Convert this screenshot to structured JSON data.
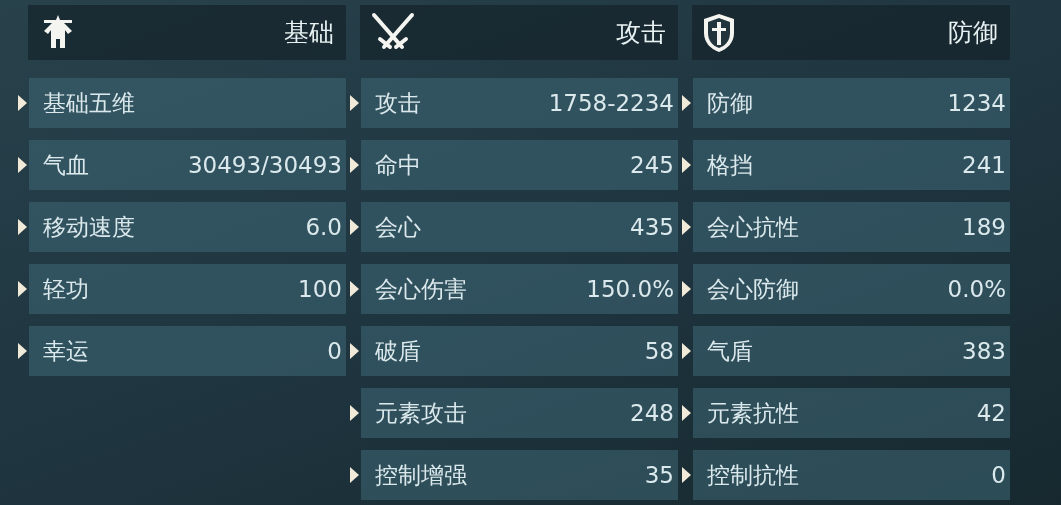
{
  "columns": [
    {
      "title": "基础",
      "rows": [
        {
          "label": "基础五维"
        },
        {
          "label": "气血",
          "value": "30493/30493"
        },
        {
          "label": "移动速度",
          "value": "6.0"
        },
        {
          "label": "轻功",
          "value": "100"
        },
        {
          "label": "幸运",
          "value": "0"
        }
      ]
    },
    {
      "title": "攻击",
      "rows": [
        {
          "label": "攻击",
          "value": "1758-2234"
        },
        {
          "label": "命中",
          "value": "245"
        },
        {
          "label": "会心",
          "value": "435"
        },
        {
          "label": "会心伤害",
          "value": "150.0%"
        },
        {
          "label": "破盾",
          "value": "58"
        },
        {
          "label": "元素攻击",
          "value": "248"
        },
        {
          "label": "控制增强",
          "value": "35"
        }
      ]
    },
    {
      "title": "防御",
      "rows": [
        {
          "label": "防御",
          "value": "1234"
        },
        {
          "label": "格挡",
          "value": "241"
        },
        {
          "label": "会心抗性",
          "value": "189"
        },
        {
          "label": "会心防御",
          "value": "0.0%"
        },
        {
          "label": "气盾",
          "value": "383"
        },
        {
          "label": "元素抗性",
          "value": "42"
        },
        {
          "label": "控制抗性",
          "value": "0"
        }
      ]
    }
  ]
}
